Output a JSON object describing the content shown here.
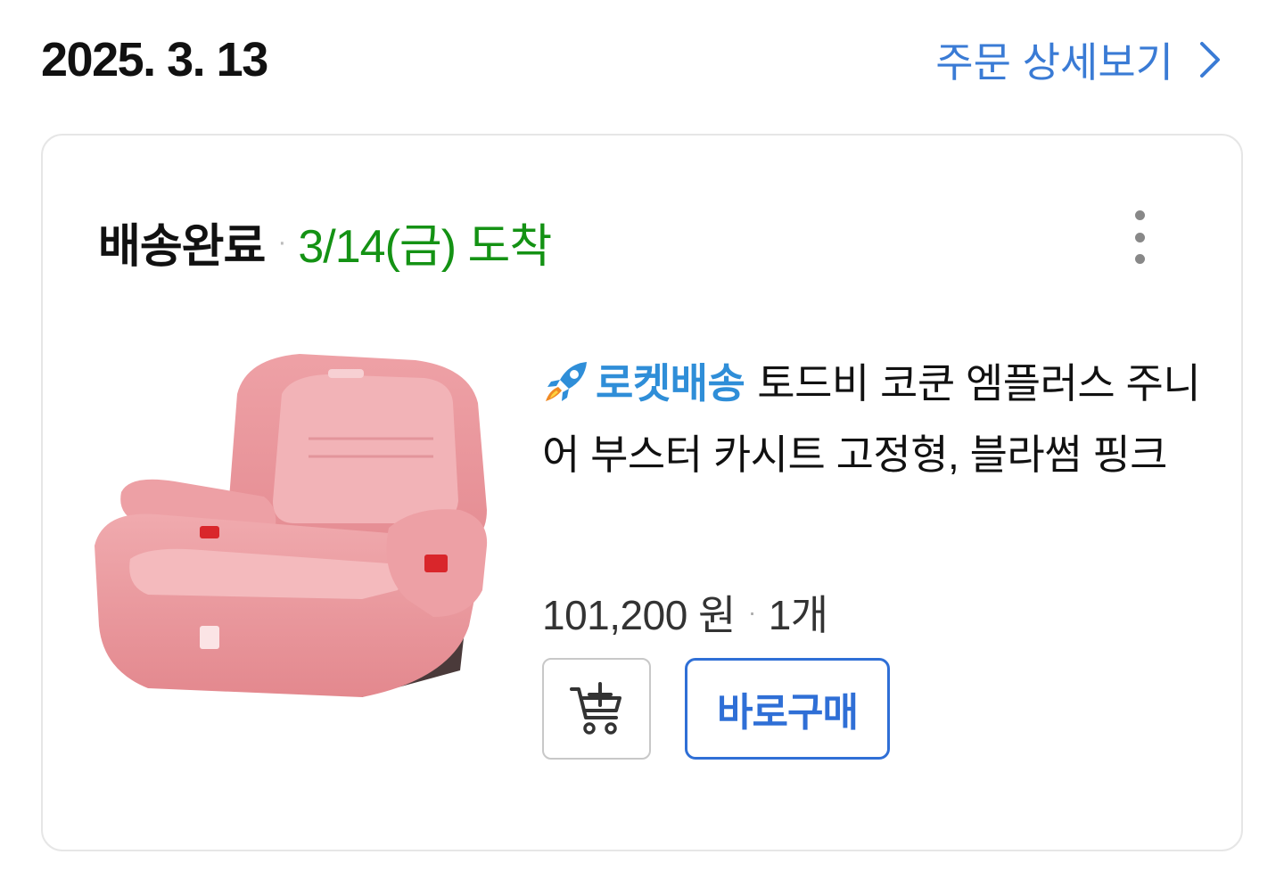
{
  "order": {
    "date": "2025. 3. 13",
    "detail_link_label": "주문 상세보기"
  },
  "card": {
    "status": "배송완료",
    "separator": "·",
    "arrival": "3/14(금) 도착",
    "product": {
      "delivery_badge": "로켓배송",
      "title": "토드비 코쿤 엠플러스 주니어 부스터 카시트 고정형, 블라썸 핑크",
      "price": "101,200 원",
      "quantity": "1개",
      "image_icon": "pink-booster-car-seat-image"
    },
    "actions": {
      "cart_icon": "add-to-cart-icon",
      "buy_now_label": "바로구매"
    }
  },
  "colors": {
    "link_blue": "#3a7bd5",
    "arrival_green": "#149214",
    "rocket_blue": "#2f8ed8",
    "buy_border": "#2f6fd6"
  }
}
